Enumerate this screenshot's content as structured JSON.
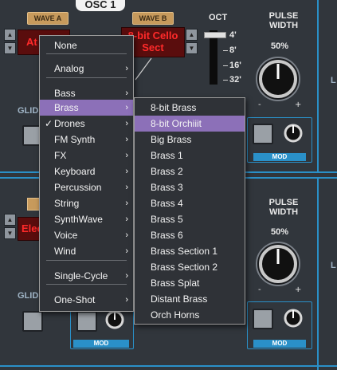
{
  "osc": {
    "title": "OSC 1",
    "wave_a_label": "WAVE A",
    "wave_b_label": "WAVE B",
    "wave_a_value_top": "At",
    "wave_b_value_top_line1": "8-bit Cello",
    "wave_b_value_top_line2": "Sect",
    "wave_a_value_bottom": "Elec",
    "oct_label": "OCT",
    "oct_values": [
      "4'",
      "8'",
      "16'",
      "32'"
    ],
    "pulse_width_label_top": "PULSE",
    "pulse_width_label_bottom": "WIDTH",
    "pulse_width_value": "50%",
    "pulse_width_value_2": "50%",
    "glide_label": "GLID",
    "mod_label": "MOD",
    "edge_label": "L"
  },
  "menu": {
    "items": [
      {
        "label": "None",
        "arrow": false,
        "checked": false
      },
      {
        "label": "Analog",
        "arrow": true,
        "checked": false
      },
      {
        "label": "Bass",
        "arrow": true,
        "checked": false
      },
      {
        "label": "Brass",
        "arrow": true,
        "checked": false,
        "highlighted": true
      },
      {
        "label": "Drones",
        "arrow": true,
        "checked": true
      },
      {
        "label": "FM Synth",
        "arrow": true,
        "checked": false
      },
      {
        "label": "FX",
        "arrow": true,
        "checked": false
      },
      {
        "label": "Keyboard",
        "arrow": true,
        "checked": false
      },
      {
        "label": "Percussion",
        "arrow": true,
        "checked": false
      },
      {
        "label": "String",
        "arrow": true,
        "checked": false
      },
      {
        "label": "SynthWave",
        "arrow": true,
        "checked": false
      },
      {
        "label": "Voice",
        "arrow": true,
        "checked": false
      },
      {
        "label": "Wind",
        "arrow": true,
        "checked": false
      },
      {
        "label": "Single-Cycle",
        "arrow": true,
        "checked": false
      },
      {
        "label": "One-Shot",
        "arrow": true,
        "checked": false
      }
    ],
    "arrow_glyph": "›",
    "check_glyph": "✓"
  },
  "submenu": {
    "items": [
      {
        "label": "8-bit Brass"
      },
      {
        "label": "8-bit Orchiiit",
        "highlighted": true
      },
      {
        "label": "Big Brass"
      },
      {
        "label": "Brass 1"
      },
      {
        "label": "Brass 2"
      },
      {
        "label": "Brass 3"
      },
      {
        "label": "Brass 4"
      },
      {
        "label": "Brass 5"
      },
      {
        "label": "Brass 6"
      },
      {
        "label": "Brass Section 1"
      },
      {
        "label": "Brass Section 2"
      },
      {
        "label": "Brass Splat"
      },
      {
        "label": "Distant Brass"
      },
      {
        "label": "Orch Horns"
      }
    ]
  },
  "colors": {
    "highlight": "#8c70b8",
    "accent": "#2a90c8",
    "display_text": "#ff2a2a"
  }
}
